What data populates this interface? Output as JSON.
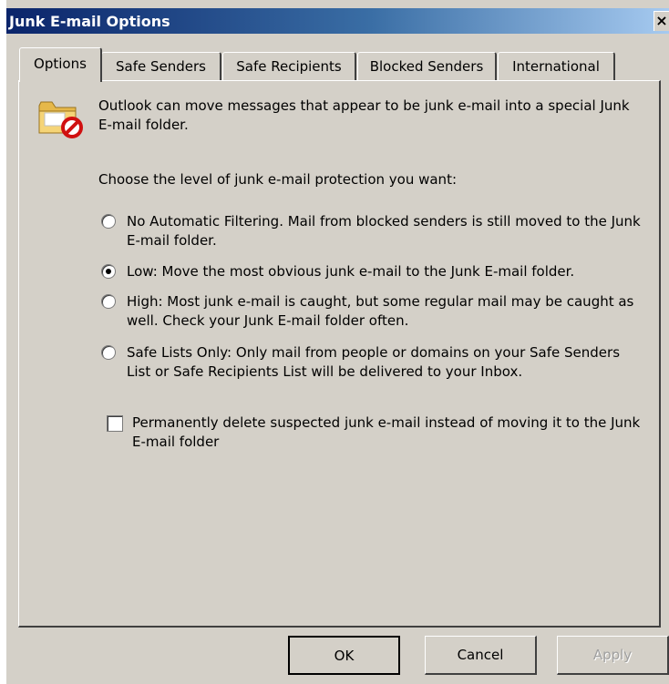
{
  "window": {
    "title": "Junk E-mail Options",
    "close_glyph": "×"
  },
  "tabs": [
    {
      "label": "Options",
      "active": true
    },
    {
      "label": "Safe Senders"
    },
    {
      "label": "Safe Recipients"
    },
    {
      "label": "Blocked Senders"
    },
    {
      "label": "International"
    }
  ],
  "options": {
    "icon": "junk-folder-icon",
    "intro": "Outlook can move messages that appear to be junk e-mail into a special Junk E-mail folder.",
    "choose_label": "Choose the level of junk e-mail protection you want:",
    "levels": [
      {
        "label": "No Automatic Filtering.  Mail from blocked senders is still moved to the Junk E-mail folder.",
        "selected": false
      },
      {
        "label": "Low: Move the most obvious junk e-mail to the Junk E-mail folder.",
        "selected": true
      },
      {
        "label": "High: Most junk e-mail is caught, but some regular mail may be caught as well. Check your Junk E-mail folder often.",
        "selected": false
      },
      {
        "label": "Safe Lists Only: Only mail from people or domains on your Safe Senders List or Safe Recipients List will be delivered to your Inbox.",
        "selected": false
      }
    ],
    "permanent_delete": {
      "label": "Permanently delete suspected junk e-mail instead of moving it to the Junk E-mail folder",
      "checked": false
    }
  },
  "buttons": {
    "ok": "OK",
    "cancel": "Cancel",
    "apply": "Apply"
  }
}
